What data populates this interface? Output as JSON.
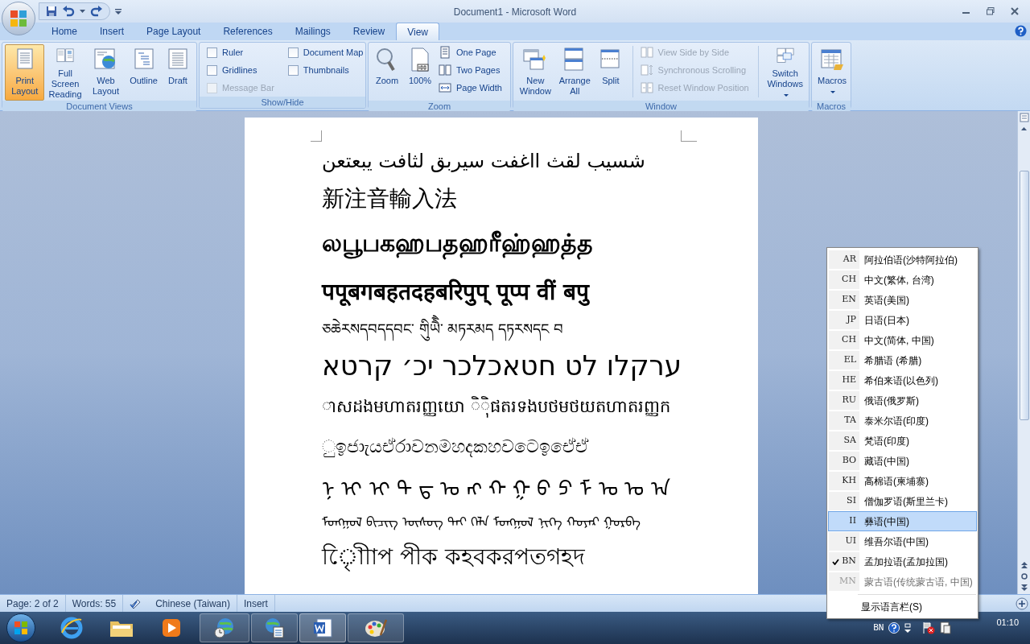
{
  "window": {
    "title": "Document1 - Microsoft Word"
  },
  "tabs": [
    {
      "label": "Home",
      "selected": false
    },
    {
      "label": "Insert",
      "selected": false
    },
    {
      "label": "Page Layout",
      "selected": false
    },
    {
      "label": "References",
      "selected": false
    },
    {
      "label": "Mailings",
      "selected": false
    },
    {
      "label": "Review",
      "selected": false
    },
    {
      "label": "View",
      "selected": true
    }
  ],
  "ribbon": {
    "groups": [
      {
        "label": "Document Views",
        "items": [
          {
            "kind": "large",
            "label": "Print Layout",
            "selected": true
          },
          {
            "kind": "large",
            "label": "Full Screen Reading",
            "selected": false
          },
          {
            "kind": "large",
            "label": "Web Layout",
            "selected": false
          },
          {
            "kind": "large",
            "label": "Outline",
            "selected": false
          },
          {
            "kind": "large",
            "label": "Draft",
            "selected": false
          }
        ]
      },
      {
        "label": "Show/Hide",
        "items": [
          {
            "kind": "checkbox",
            "label": "Ruler",
            "checked": false,
            "disabled": false
          },
          {
            "kind": "checkbox",
            "label": "Gridlines",
            "checked": false,
            "disabled": false
          },
          {
            "kind": "checkbox",
            "label": "Message Bar",
            "checked": false,
            "disabled": true
          },
          {
            "kind": "checkbox",
            "label": "Document Map",
            "checked": false,
            "disabled": false
          },
          {
            "kind": "checkbox",
            "label": "Thumbnails",
            "checked": false,
            "disabled": false
          }
        ]
      },
      {
        "label": "Zoom",
        "items": [
          {
            "kind": "large",
            "label": "Zoom",
            "selected": false
          },
          {
            "kind": "large",
            "label": "100%",
            "selected": false
          },
          {
            "kind": "small",
            "label": "One Page",
            "disabled": false
          },
          {
            "kind": "small",
            "label": "Two Pages",
            "disabled": false
          },
          {
            "kind": "small",
            "label": "Page Width",
            "disabled": false
          }
        ]
      },
      {
        "label": "Window",
        "items": [
          {
            "kind": "large",
            "label": "New Window",
            "selected": false
          },
          {
            "kind": "large",
            "label": "Arrange All",
            "selected": false
          },
          {
            "kind": "large",
            "label": "Split",
            "selected": false
          },
          {
            "kind": "small",
            "label": "View Side by Side",
            "disabled": true
          },
          {
            "kind": "small",
            "label": "Synchronous Scrolling",
            "disabled": true
          },
          {
            "kind": "small",
            "label": "Reset Window Position",
            "disabled": true
          },
          {
            "kind": "large",
            "label": "Switch Windows",
            "selected": false,
            "dropdown": true
          }
        ]
      },
      {
        "label": "Macros",
        "items": [
          {
            "kind": "large",
            "label": "Macros",
            "selected": false,
            "dropdown": true
          }
        ]
      }
    ]
  },
  "document": {
    "lines": [
      {
        "text": "شسيب لقث ااغفت سيربق لثافت يبعتعن"
      },
      {
        "text": "新注音輸入法"
      },
      {
        "text": "லபூபகஹபதஹரீஹ்ஹத்த"
      },
      {
        "text": "पपूबगबहतदहबरिपुप्   पूप्प वीं बपु"
      },
      {
        "text": "ཅཆེརསདབདདབང་ གིུཡཻཻ་ མཏརམད དཏརསདང བ"
      },
      {
        "text": "ערקלו לט חטאכלכר יכ׳ קרטא"
      },
      {
        "text": "ាសដងមហាតរញ្ញយោ ិុិផតរទងបថមថយតហាតរញ្ញក"
      },
      {
        "text": "ුඉජාැයඒරාවනමහදකහවටෙඉඒෙඒ"
      },
      {
        "text": "ᠨ ᠢ ᠢ ᠲ ᠳ ᠣ ᠩ ᠬ ᠭ ᠪ ᠫ ᠮ ᠤ ᠣ ᠠ"
      },
      {
        "text": "ᠮᠣᠩᠭᠣᠯ ᠪᠢᠴᠢᠭ ᠦᠰᠦᠭ ᠲᠠᠢ ᠬᠡᠯᠡ ᠮᠣᠩᠭᠣᠯ ᠨᠢᠭᠡ ᠬᠣᠶᠠᠷ ᠭᠤᠷᠪᠠ"
      },
      {
        "text": "োৃিীাপ  পীক  কহবকরপতগহদ"
      }
    ]
  },
  "status_bar": {
    "items": [
      "Page: 2 of 2",
      "Words: 55",
      "Chinese (Taiwan)",
      "Insert"
    ]
  },
  "language_menu": {
    "items": [
      {
        "code": "AR",
        "label": "阿拉伯语(沙特阿拉伯)",
        "selected": false,
        "checked": false,
        "disabled": false
      },
      {
        "code": "CH",
        "label": "中文(繁体, 台湾)",
        "selected": false,
        "checked": false,
        "disabled": false
      },
      {
        "code": "EN",
        "label": "英语(美国)",
        "selected": false,
        "checked": false,
        "disabled": false
      },
      {
        "code": "JP",
        "label": "日语(日本)",
        "selected": false,
        "checked": false,
        "disabled": false
      },
      {
        "code": "CH",
        "label": "中文(简体, 中国)",
        "selected": false,
        "checked": false,
        "disabled": false
      },
      {
        "code": "EL",
        "label": "希腊语 (希腊)",
        "selected": false,
        "checked": false,
        "disabled": false
      },
      {
        "code": "HE",
        "label": "希伯来语(以色列)",
        "selected": false,
        "checked": false,
        "disabled": false
      },
      {
        "code": "RU",
        "label": "俄语(俄罗斯)",
        "selected": false,
        "checked": false,
        "disabled": false
      },
      {
        "code": "TA",
        "label": "泰米尔语(印度)",
        "selected": false,
        "checked": false,
        "disabled": false
      },
      {
        "code": "SA",
        "label": "梵语(印度)",
        "selected": false,
        "checked": false,
        "disabled": false
      },
      {
        "code": "BO",
        "label": "藏语(中国)",
        "selected": false,
        "checked": false,
        "disabled": false
      },
      {
        "code": "KH",
        "label": "高棉语(柬埔寨)",
        "selected": false,
        "checked": false,
        "disabled": false
      },
      {
        "code": "SI",
        "label": "僧伽罗语(斯里兰卡)",
        "selected": false,
        "checked": false,
        "disabled": false
      },
      {
        "code": "II",
        "label": "彝语(中国)",
        "selected": true,
        "checked": false,
        "disabled": false
      },
      {
        "code": "UI",
        "label": "维吾尔语(中国)",
        "selected": false,
        "checked": false,
        "disabled": false
      },
      {
        "code": "BN",
        "label": "孟加拉语(孟加拉国)",
        "selected": false,
        "checked": true,
        "disabled": false
      },
      {
        "code": "MN",
        "label": "蒙古语(传统蒙古语, 中国)",
        "selected": false,
        "checked": false,
        "disabled": true
      }
    ],
    "footer": "显示语言栏(S)"
  },
  "tray": {
    "language": "BN",
    "time": "01:10"
  }
}
